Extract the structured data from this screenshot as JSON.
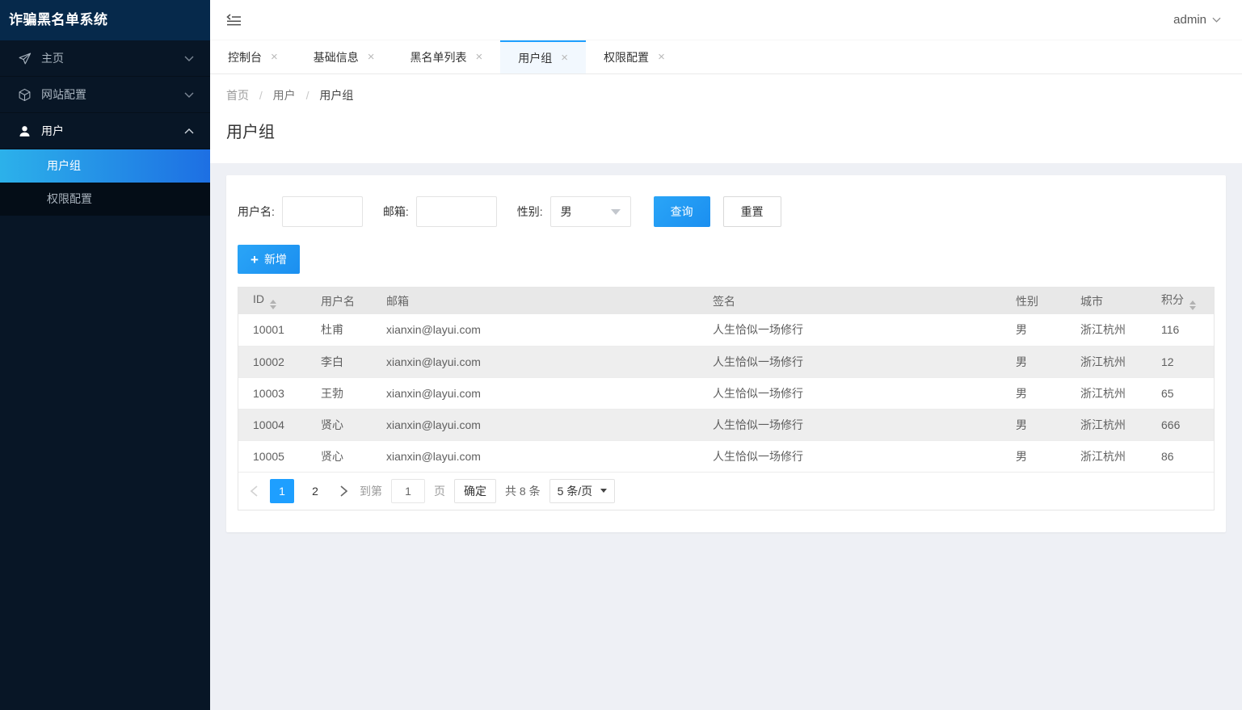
{
  "app": {
    "title": "诈骗黑名单系统"
  },
  "topbar": {
    "user": "admin"
  },
  "icons": {
    "close": "×",
    "plus": "+"
  },
  "colors": {
    "accent": "#1e9fff",
    "sidebar_bg": "#081626",
    "logo_bg": "#06294b",
    "submenu_bg": "#040d17",
    "selected_gradient_start": "#2cb1ea",
    "selected_gradient_end": "#1d6fe3",
    "table_header_bg": "#e8e8e8",
    "zebra_row_bg": "#eeeeee",
    "content_bg": "#eef0f5"
  },
  "sidebar": {
    "items": [
      {
        "label": "主页",
        "icon": "send-icon",
        "state": "collapsed"
      },
      {
        "label": "网站配置",
        "icon": "cube-icon",
        "state": "collapsed"
      },
      {
        "label": "用户",
        "icon": "user-icon",
        "state": "expanded"
      }
    ],
    "subitems": [
      {
        "label": "用户组",
        "selected": true
      },
      {
        "label": "权限配置",
        "selected": false
      }
    ]
  },
  "tabs": [
    {
      "label": "控制台",
      "active": false
    },
    {
      "label": "基础信息",
      "active": false
    },
    {
      "label": "黑名单列表",
      "active": false
    },
    {
      "label": "用户组",
      "active": true
    },
    {
      "label": "权限配置",
      "active": false
    }
  ],
  "breadcrumb": {
    "items": [
      "首页",
      "用户",
      "用户组"
    ],
    "separator": "/"
  },
  "page": {
    "title": "用户组"
  },
  "filter": {
    "username_label": "用户名:",
    "username_value": "",
    "email_label": "邮箱:",
    "email_value": "",
    "gender_label": "性别:",
    "gender_value": "男",
    "search_label": "查询",
    "reset_label": "重置",
    "add_label": "新增"
  },
  "table": {
    "columns": [
      "ID",
      "用户名",
      "邮箱",
      "签名",
      "性别",
      "城市",
      "积分"
    ],
    "sortable_columns": [
      "ID",
      "积分"
    ],
    "rows": [
      [
        "10001",
        "杜甫",
        "xianxin@layui.com",
        "人生恰似一场修行",
        "男",
        "浙江杭州",
        "116"
      ],
      [
        "10002",
        "李白",
        "xianxin@layui.com",
        "人生恰似一场修行",
        "男",
        "浙江杭州",
        "12"
      ],
      [
        "10003",
        "王勃",
        "xianxin@layui.com",
        "人生恰似一场修行",
        "男",
        "浙江杭州",
        "65"
      ],
      [
        "10004",
        "贤心",
        "xianxin@layui.com",
        "人生恰似一场修行",
        "男",
        "浙江杭州",
        "666"
      ],
      [
        "10005",
        "贤心",
        "xianxin@layui.com",
        "人生恰似一场修行",
        "男",
        "浙江杭州",
        "86"
      ]
    ]
  },
  "pagination": {
    "pages": [
      "1",
      "2"
    ],
    "current": "1",
    "goto_label": "到第",
    "goto_value": "1",
    "page_unit": "页",
    "confirm_label": "确定",
    "total_label": "共 8 条",
    "per_page": "5 条/页"
  }
}
